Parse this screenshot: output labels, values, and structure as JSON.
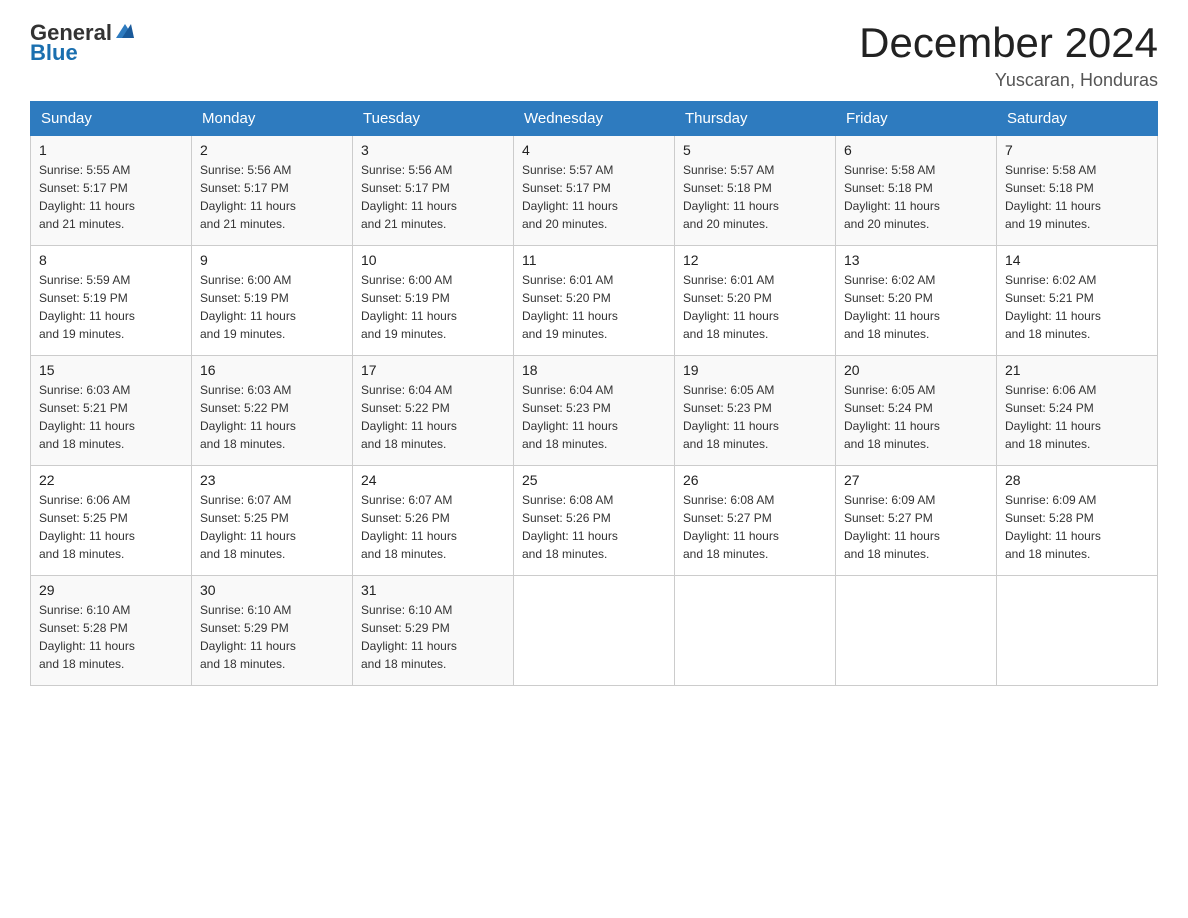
{
  "logo": {
    "text_general": "General",
    "text_blue": "Blue"
  },
  "title": "December 2024",
  "location": "Yuscaran, Honduras",
  "days_of_week": [
    "Sunday",
    "Monday",
    "Tuesday",
    "Wednesday",
    "Thursday",
    "Friday",
    "Saturday"
  ],
  "weeks": [
    [
      {
        "day": "1",
        "sunrise": "5:55 AM",
        "sunset": "5:17 PM",
        "daylight": "11 hours and 21 minutes."
      },
      {
        "day": "2",
        "sunrise": "5:56 AM",
        "sunset": "5:17 PM",
        "daylight": "11 hours and 21 minutes."
      },
      {
        "day": "3",
        "sunrise": "5:56 AM",
        "sunset": "5:17 PM",
        "daylight": "11 hours and 21 minutes."
      },
      {
        "day": "4",
        "sunrise": "5:57 AM",
        "sunset": "5:17 PM",
        "daylight": "11 hours and 20 minutes."
      },
      {
        "day": "5",
        "sunrise": "5:57 AM",
        "sunset": "5:18 PM",
        "daylight": "11 hours and 20 minutes."
      },
      {
        "day": "6",
        "sunrise": "5:58 AM",
        "sunset": "5:18 PM",
        "daylight": "11 hours and 20 minutes."
      },
      {
        "day": "7",
        "sunrise": "5:58 AM",
        "sunset": "5:18 PM",
        "daylight": "11 hours and 19 minutes."
      }
    ],
    [
      {
        "day": "8",
        "sunrise": "5:59 AM",
        "sunset": "5:19 PM",
        "daylight": "11 hours and 19 minutes."
      },
      {
        "day": "9",
        "sunrise": "6:00 AM",
        "sunset": "5:19 PM",
        "daylight": "11 hours and 19 minutes."
      },
      {
        "day": "10",
        "sunrise": "6:00 AM",
        "sunset": "5:19 PM",
        "daylight": "11 hours and 19 minutes."
      },
      {
        "day": "11",
        "sunrise": "6:01 AM",
        "sunset": "5:20 PM",
        "daylight": "11 hours and 19 minutes."
      },
      {
        "day": "12",
        "sunrise": "6:01 AM",
        "sunset": "5:20 PM",
        "daylight": "11 hours and 18 minutes."
      },
      {
        "day": "13",
        "sunrise": "6:02 AM",
        "sunset": "5:20 PM",
        "daylight": "11 hours and 18 minutes."
      },
      {
        "day": "14",
        "sunrise": "6:02 AM",
        "sunset": "5:21 PM",
        "daylight": "11 hours and 18 minutes."
      }
    ],
    [
      {
        "day": "15",
        "sunrise": "6:03 AM",
        "sunset": "5:21 PM",
        "daylight": "11 hours and 18 minutes."
      },
      {
        "day": "16",
        "sunrise": "6:03 AM",
        "sunset": "5:22 PM",
        "daylight": "11 hours and 18 minutes."
      },
      {
        "day": "17",
        "sunrise": "6:04 AM",
        "sunset": "5:22 PM",
        "daylight": "11 hours and 18 minutes."
      },
      {
        "day": "18",
        "sunrise": "6:04 AM",
        "sunset": "5:23 PM",
        "daylight": "11 hours and 18 minutes."
      },
      {
        "day": "19",
        "sunrise": "6:05 AM",
        "sunset": "5:23 PM",
        "daylight": "11 hours and 18 minutes."
      },
      {
        "day": "20",
        "sunrise": "6:05 AM",
        "sunset": "5:24 PM",
        "daylight": "11 hours and 18 minutes."
      },
      {
        "day": "21",
        "sunrise": "6:06 AM",
        "sunset": "5:24 PM",
        "daylight": "11 hours and 18 minutes."
      }
    ],
    [
      {
        "day": "22",
        "sunrise": "6:06 AM",
        "sunset": "5:25 PM",
        "daylight": "11 hours and 18 minutes."
      },
      {
        "day": "23",
        "sunrise": "6:07 AM",
        "sunset": "5:25 PM",
        "daylight": "11 hours and 18 minutes."
      },
      {
        "day": "24",
        "sunrise": "6:07 AM",
        "sunset": "5:26 PM",
        "daylight": "11 hours and 18 minutes."
      },
      {
        "day": "25",
        "sunrise": "6:08 AM",
        "sunset": "5:26 PM",
        "daylight": "11 hours and 18 minutes."
      },
      {
        "day": "26",
        "sunrise": "6:08 AM",
        "sunset": "5:27 PM",
        "daylight": "11 hours and 18 minutes."
      },
      {
        "day": "27",
        "sunrise": "6:09 AM",
        "sunset": "5:27 PM",
        "daylight": "11 hours and 18 minutes."
      },
      {
        "day": "28",
        "sunrise": "6:09 AM",
        "sunset": "5:28 PM",
        "daylight": "11 hours and 18 minutes."
      }
    ],
    [
      {
        "day": "29",
        "sunrise": "6:10 AM",
        "sunset": "5:28 PM",
        "daylight": "11 hours and 18 minutes."
      },
      {
        "day": "30",
        "sunrise": "6:10 AM",
        "sunset": "5:29 PM",
        "daylight": "11 hours and 18 minutes."
      },
      {
        "day": "31",
        "sunrise": "6:10 AM",
        "sunset": "5:29 PM",
        "daylight": "11 hours and 18 minutes."
      },
      null,
      null,
      null,
      null
    ]
  ]
}
